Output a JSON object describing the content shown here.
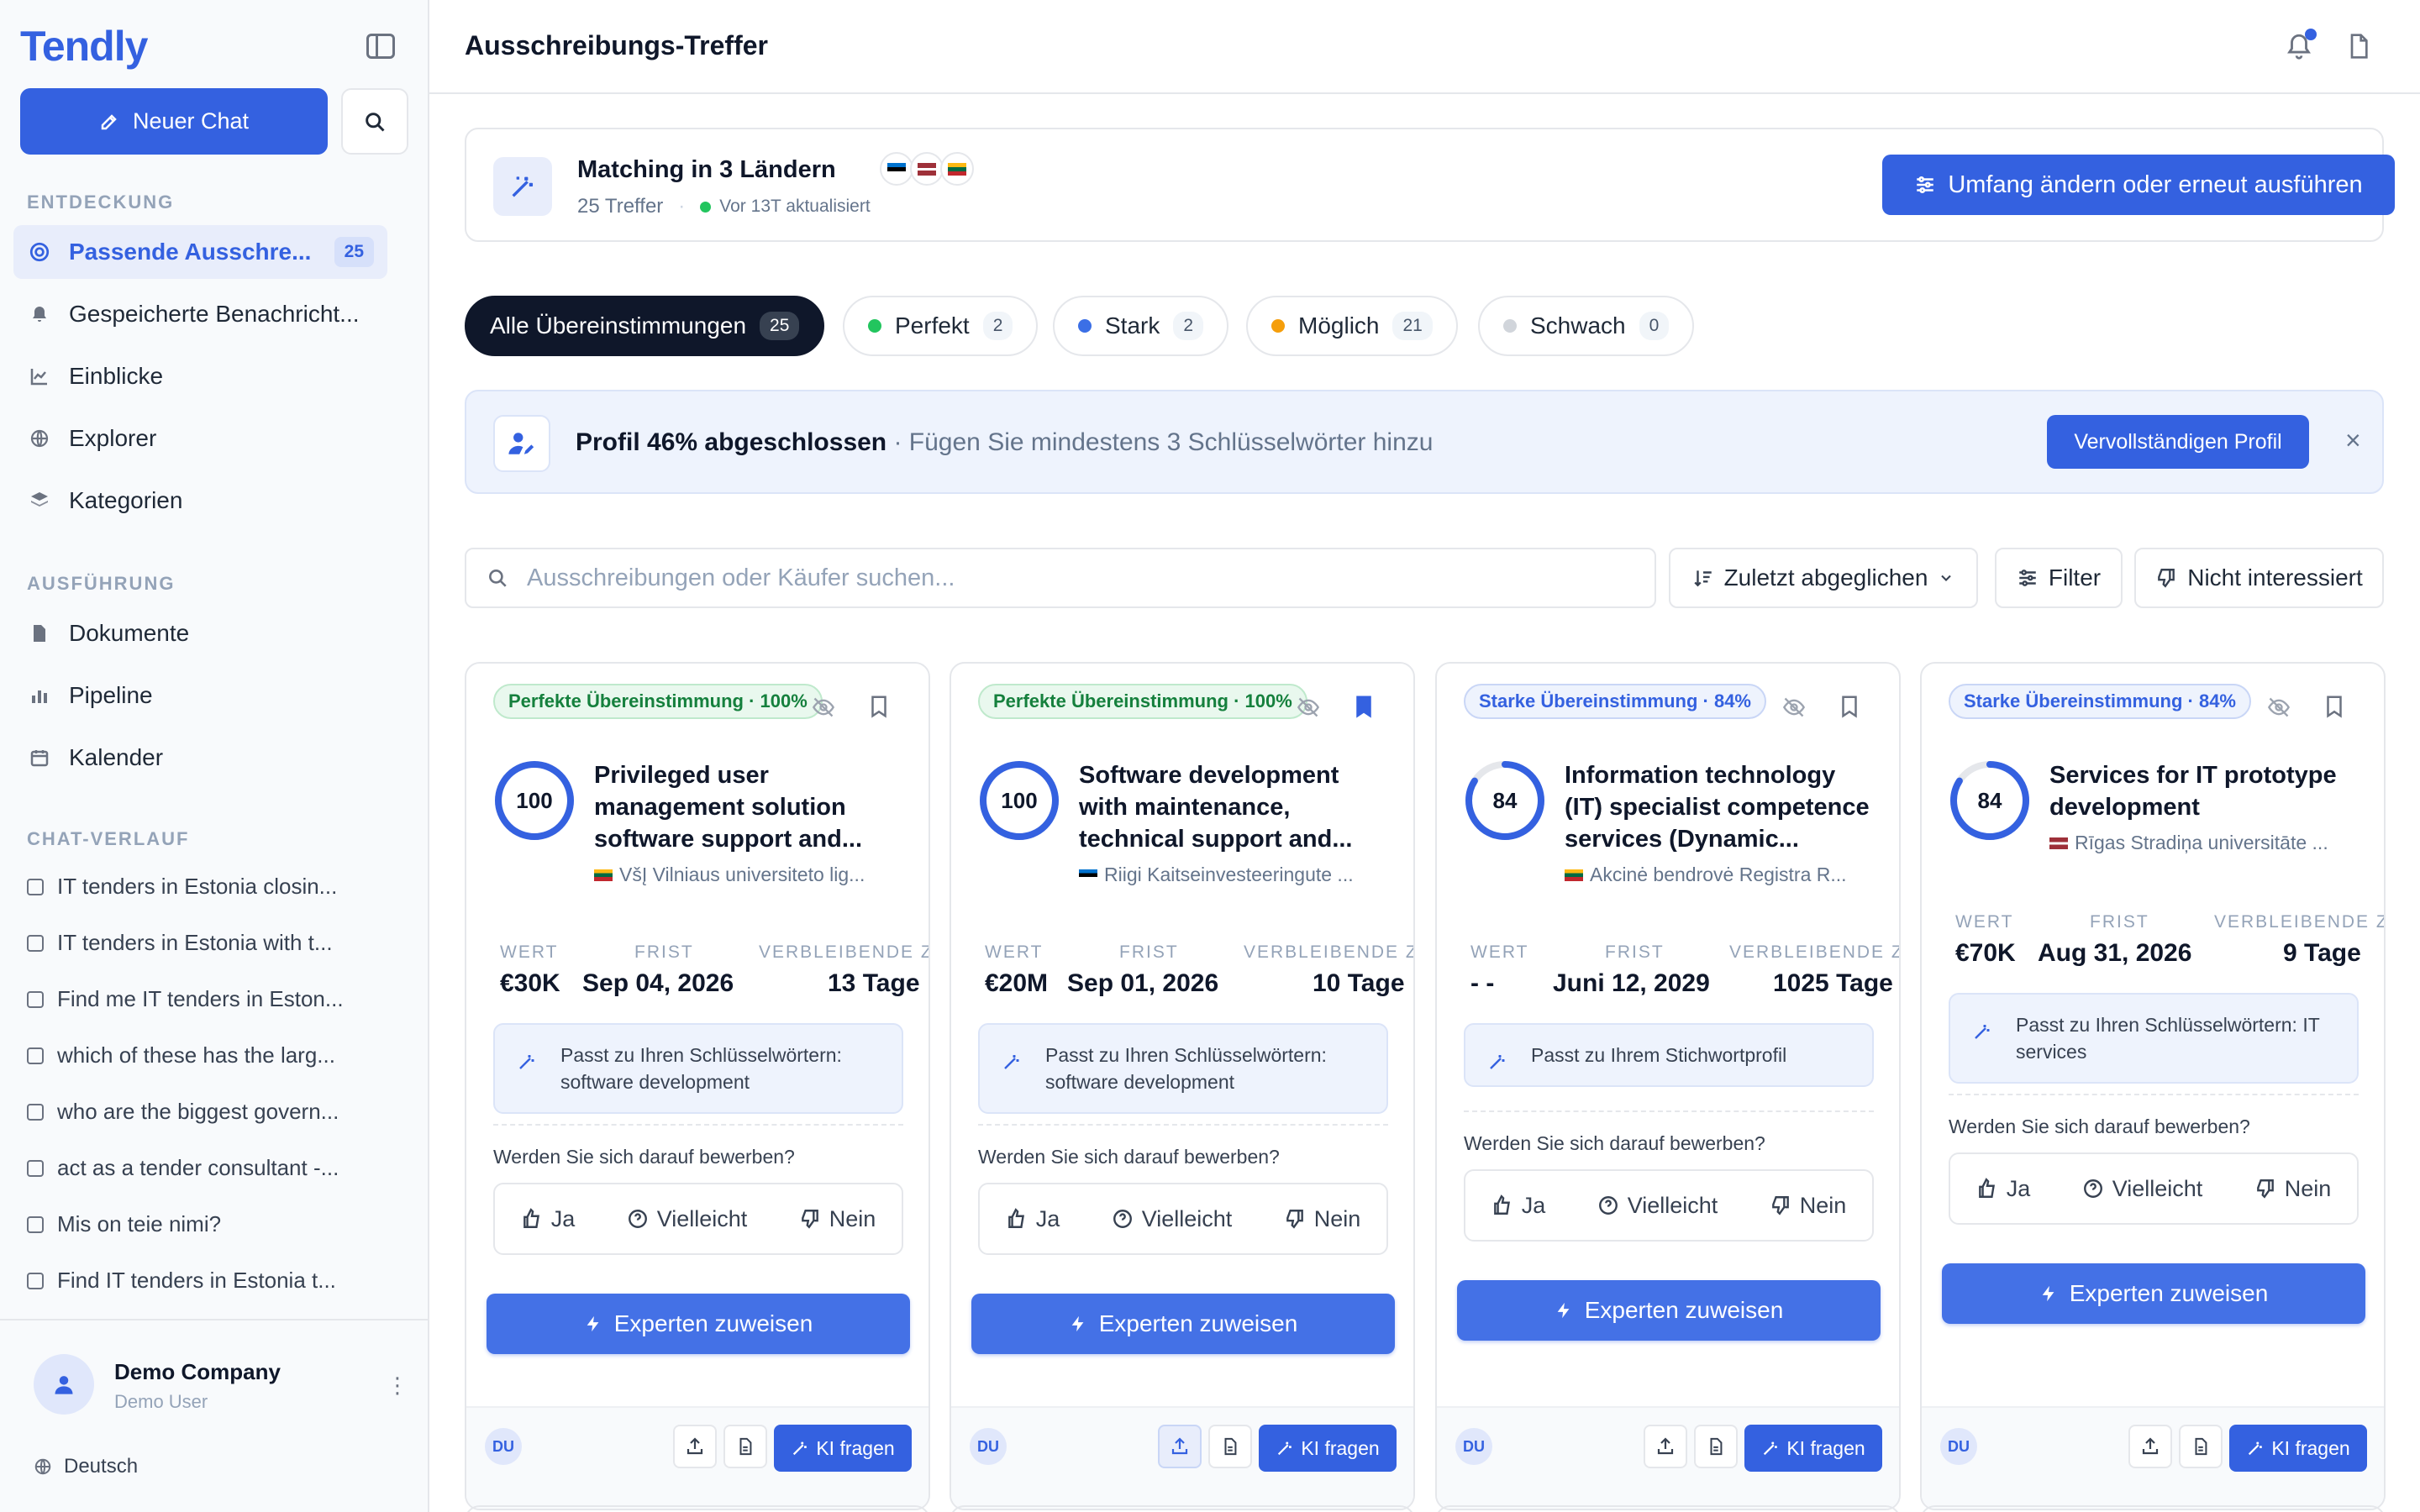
{
  "sidebar": {
    "logo": "Tendly",
    "new_chat": "Neuer Chat",
    "sections": {
      "discovery": "ENTDECKUNG",
      "execution": "AUSFÜHRUNG",
      "history": "CHAT-VERLAUF"
    },
    "discovery_items": [
      {
        "label": "Passende Ausschre...",
        "badge": "25",
        "icon": "target-icon"
      },
      {
        "label": "Gespeicherte Benachricht...",
        "icon": "bell-icon"
      },
      {
        "label": "Einblicke",
        "icon": "chart-line-icon"
      },
      {
        "label": "Explorer",
        "icon": "globe-icon"
      },
      {
        "label": "Kategorien",
        "icon": "layers-icon"
      }
    ],
    "execution_items": [
      {
        "label": "Dokumente",
        "icon": "document-icon"
      },
      {
        "label": "Pipeline",
        "icon": "bar-chart-icon"
      },
      {
        "label": "Kalender",
        "icon": "calendar-icon"
      }
    ],
    "chat_history": [
      "IT tenders in Estonia closin...",
      "IT tenders in Estonia with t...",
      "Find me IT tenders in Eston...",
      "which of these has the larg...",
      "who are the biggest govern...",
      "act as a tender consultant -...",
      "Mis on teie nimi?",
      "Find IT tenders in Estonia t..."
    ],
    "user": {
      "name": "Demo Company",
      "role": "Demo User"
    },
    "language": "Deutsch"
  },
  "header": {
    "title": "Ausschreibungs-Treffer"
  },
  "matching": {
    "title": "Matching in 3 Ländern",
    "count": "25 Treffer",
    "updated": "Vor 13T aktualisiert",
    "scope_button": "Umfang ändern oder erneut ausführen"
  },
  "tabs": [
    {
      "label": "Alle Übereinstimmungen",
      "count": "25",
      "color": ""
    },
    {
      "label": "Perfekt",
      "count": "2",
      "color": "#22c55e"
    },
    {
      "label": "Stark",
      "count": "2",
      "color": "#3b6fe6"
    },
    {
      "label": "Möglich",
      "count": "21",
      "color": "#f59e0b"
    },
    {
      "label": "Schwach",
      "count": "0",
      "color": "#d1d5db"
    }
  ],
  "profile": {
    "bold": "Profil 46% abgeschlossen",
    "rest": " · Fügen Sie mindestens 3 Schlüsselwörter hinzu",
    "button": "Vervollständigen  Profil"
  },
  "search": {
    "placeholder": "Ausschreibungen oder Käufer suchen..."
  },
  "controls": {
    "sort": "Zuletzt abgeglichen",
    "filter": "Filter",
    "not_interested": "Nicht interessiert"
  },
  "labels": {
    "value": "WERT",
    "deadline": "FRIST",
    "remaining": "VERBLEIBENDE ZEIT",
    "question": "Werden Sie sich darauf bewerben?",
    "yes": "Ja",
    "maybe": "Vielleicht",
    "no": "Nein",
    "expert": "Experten zuweisen",
    "ask_ai": "KI fragen",
    "user_initials": "DU"
  },
  "cards": [
    {
      "badge": "Perfekte Übereinstimmung · 100%",
      "score": 100,
      "title": "Privileged user management solution software support and...",
      "buyer": "VšĮ Vilniaus universiteto lig...",
      "country": "LT",
      "value": "€30K",
      "deadline": "Sep 04, 2026",
      "remaining": "13 Tage",
      "reason": "Passt zu Ihren Schlüsselwörtern: software development",
      "saved": false
    },
    {
      "badge": "Perfekte Übereinstimmung · 100%",
      "score": 100,
      "title": "Software development with maintenance, technical support and...",
      "buyer": "Riigi Kaitseinvesteeringute ...",
      "country": "EE",
      "value": "€20M",
      "deadline": "Sep 01, 2026",
      "remaining": "10 Tage",
      "reason": "Passt zu Ihren Schlüsselwörtern: software development",
      "saved": true
    },
    {
      "badge": "Starke Übereinstimmung · 84%",
      "score": 84,
      "title": "Information technology (IT) specialist competence services (Dynamic...",
      "buyer": "Akcinė bendrovė Registra  R...",
      "country": "LT",
      "value": "- -",
      "deadline": "Juni 12, 2029",
      "remaining": "1025 Tage",
      "reason": "Passt zu Ihrem Stichwortprofil",
      "saved": false
    },
    {
      "badge": "Starke Übereinstimmung · 84%",
      "score": 84,
      "title": "Services for IT prototype development",
      "buyer": "Rīgas Stradiņa universitāte ...",
      "country": "LV",
      "value": "€70K",
      "deadline": "Aug 31, 2026",
      "remaining": "9 Tage",
      "reason": "Passt zu Ihren Schlüsselwörtern: IT services",
      "saved": false
    }
  ]
}
